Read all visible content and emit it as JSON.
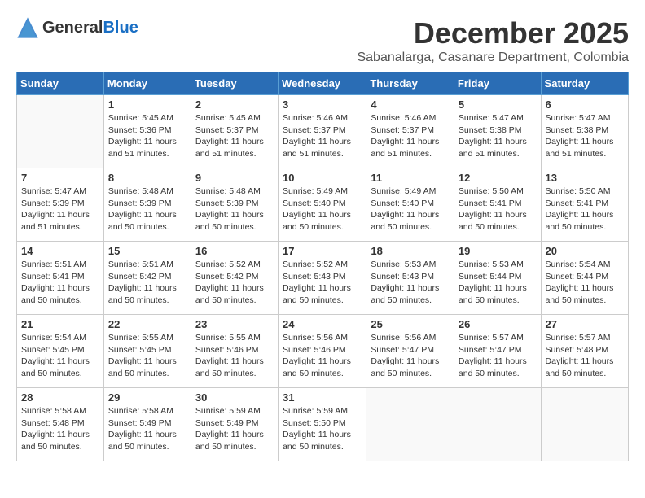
{
  "header": {
    "logo_general": "General",
    "logo_blue": "Blue",
    "month_title": "December 2025",
    "location": "Sabanalarga, Casanare Department, Colombia"
  },
  "weekdays": [
    "Sunday",
    "Monday",
    "Tuesday",
    "Wednesday",
    "Thursday",
    "Friday",
    "Saturday"
  ],
  "weeks": [
    [
      {
        "day": "",
        "sunrise": "",
        "sunset": "",
        "daylight": ""
      },
      {
        "day": "1",
        "sunrise": "Sunrise: 5:45 AM",
        "sunset": "Sunset: 5:36 PM",
        "daylight": "Daylight: 11 hours and 51 minutes."
      },
      {
        "day": "2",
        "sunrise": "Sunrise: 5:45 AM",
        "sunset": "Sunset: 5:37 PM",
        "daylight": "Daylight: 11 hours and 51 minutes."
      },
      {
        "day": "3",
        "sunrise": "Sunrise: 5:46 AM",
        "sunset": "Sunset: 5:37 PM",
        "daylight": "Daylight: 11 hours and 51 minutes."
      },
      {
        "day": "4",
        "sunrise": "Sunrise: 5:46 AM",
        "sunset": "Sunset: 5:37 PM",
        "daylight": "Daylight: 11 hours and 51 minutes."
      },
      {
        "day": "5",
        "sunrise": "Sunrise: 5:47 AM",
        "sunset": "Sunset: 5:38 PM",
        "daylight": "Daylight: 11 hours and 51 minutes."
      },
      {
        "day": "6",
        "sunrise": "Sunrise: 5:47 AM",
        "sunset": "Sunset: 5:38 PM",
        "daylight": "Daylight: 11 hours and 51 minutes."
      }
    ],
    [
      {
        "day": "7",
        "sunrise": "Sunrise: 5:47 AM",
        "sunset": "Sunset: 5:39 PM",
        "daylight": "Daylight: 11 hours and 51 minutes."
      },
      {
        "day": "8",
        "sunrise": "Sunrise: 5:48 AM",
        "sunset": "Sunset: 5:39 PM",
        "daylight": "Daylight: 11 hours and 50 minutes."
      },
      {
        "day": "9",
        "sunrise": "Sunrise: 5:48 AM",
        "sunset": "Sunset: 5:39 PM",
        "daylight": "Daylight: 11 hours and 50 minutes."
      },
      {
        "day": "10",
        "sunrise": "Sunrise: 5:49 AM",
        "sunset": "Sunset: 5:40 PM",
        "daylight": "Daylight: 11 hours and 50 minutes."
      },
      {
        "day": "11",
        "sunrise": "Sunrise: 5:49 AM",
        "sunset": "Sunset: 5:40 PM",
        "daylight": "Daylight: 11 hours and 50 minutes."
      },
      {
        "day": "12",
        "sunrise": "Sunrise: 5:50 AM",
        "sunset": "Sunset: 5:41 PM",
        "daylight": "Daylight: 11 hours and 50 minutes."
      },
      {
        "day": "13",
        "sunrise": "Sunrise: 5:50 AM",
        "sunset": "Sunset: 5:41 PM",
        "daylight": "Daylight: 11 hours and 50 minutes."
      }
    ],
    [
      {
        "day": "14",
        "sunrise": "Sunrise: 5:51 AM",
        "sunset": "Sunset: 5:41 PM",
        "daylight": "Daylight: 11 hours and 50 minutes."
      },
      {
        "day": "15",
        "sunrise": "Sunrise: 5:51 AM",
        "sunset": "Sunset: 5:42 PM",
        "daylight": "Daylight: 11 hours and 50 minutes."
      },
      {
        "day": "16",
        "sunrise": "Sunrise: 5:52 AM",
        "sunset": "Sunset: 5:42 PM",
        "daylight": "Daylight: 11 hours and 50 minutes."
      },
      {
        "day": "17",
        "sunrise": "Sunrise: 5:52 AM",
        "sunset": "Sunset: 5:43 PM",
        "daylight": "Daylight: 11 hours and 50 minutes."
      },
      {
        "day": "18",
        "sunrise": "Sunrise: 5:53 AM",
        "sunset": "Sunset: 5:43 PM",
        "daylight": "Daylight: 11 hours and 50 minutes."
      },
      {
        "day": "19",
        "sunrise": "Sunrise: 5:53 AM",
        "sunset": "Sunset: 5:44 PM",
        "daylight": "Daylight: 11 hours and 50 minutes."
      },
      {
        "day": "20",
        "sunrise": "Sunrise: 5:54 AM",
        "sunset": "Sunset: 5:44 PM",
        "daylight": "Daylight: 11 hours and 50 minutes."
      }
    ],
    [
      {
        "day": "21",
        "sunrise": "Sunrise: 5:54 AM",
        "sunset": "Sunset: 5:45 PM",
        "daylight": "Daylight: 11 hours and 50 minutes."
      },
      {
        "day": "22",
        "sunrise": "Sunrise: 5:55 AM",
        "sunset": "Sunset: 5:45 PM",
        "daylight": "Daylight: 11 hours and 50 minutes."
      },
      {
        "day": "23",
        "sunrise": "Sunrise: 5:55 AM",
        "sunset": "Sunset: 5:46 PM",
        "daylight": "Daylight: 11 hours and 50 minutes."
      },
      {
        "day": "24",
        "sunrise": "Sunrise: 5:56 AM",
        "sunset": "Sunset: 5:46 PM",
        "daylight": "Daylight: 11 hours and 50 minutes."
      },
      {
        "day": "25",
        "sunrise": "Sunrise: 5:56 AM",
        "sunset": "Sunset: 5:47 PM",
        "daylight": "Daylight: 11 hours and 50 minutes."
      },
      {
        "day": "26",
        "sunrise": "Sunrise: 5:57 AM",
        "sunset": "Sunset: 5:47 PM",
        "daylight": "Daylight: 11 hours and 50 minutes."
      },
      {
        "day": "27",
        "sunrise": "Sunrise: 5:57 AM",
        "sunset": "Sunset: 5:48 PM",
        "daylight": "Daylight: 11 hours and 50 minutes."
      }
    ],
    [
      {
        "day": "28",
        "sunrise": "Sunrise: 5:58 AM",
        "sunset": "Sunset: 5:48 PM",
        "daylight": "Daylight: 11 hours and 50 minutes."
      },
      {
        "day": "29",
        "sunrise": "Sunrise: 5:58 AM",
        "sunset": "Sunset: 5:49 PM",
        "daylight": "Daylight: 11 hours and 50 minutes."
      },
      {
        "day": "30",
        "sunrise": "Sunrise: 5:59 AM",
        "sunset": "Sunset: 5:49 PM",
        "daylight": "Daylight: 11 hours and 50 minutes."
      },
      {
        "day": "31",
        "sunrise": "Sunrise: 5:59 AM",
        "sunset": "Sunset: 5:50 PM",
        "daylight": "Daylight: 11 hours and 50 minutes."
      },
      {
        "day": "",
        "sunrise": "",
        "sunset": "",
        "daylight": ""
      },
      {
        "day": "",
        "sunrise": "",
        "sunset": "",
        "daylight": ""
      },
      {
        "day": "",
        "sunrise": "",
        "sunset": "",
        "daylight": ""
      }
    ]
  ]
}
